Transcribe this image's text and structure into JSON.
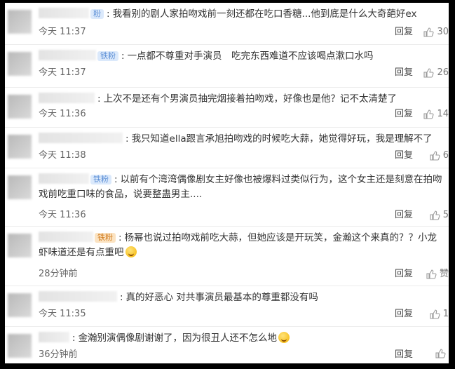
{
  "comments": [
    {
      "badge": "粉",
      "text": "我看别的剧人家拍吻戏前一刻还都在吃口香糖...他到底是什么大奇葩好ex",
      "time": "今天 11:37",
      "reply": "回复",
      "likes": "30"
    },
    {
      "badge": "铁粉",
      "text": "一点都不尊重对手演员　吃完东西难道不应该喝点漱口水吗",
      "time": "今天 11:37",
      "reply": "回复",
      "likes": "26"
    },
    {
      "badge": "",
      "text": "上次不是还有个男演员抽完烟接着拍吻戏，好像也是他？记不太清楚了",
      "time": "今天 11:36",
      "reply": "回复",
      "likes": "14"
    },
    {
      "badge": "",
      "text": "我只知道ella跟言承旭拍吻戏的时候吃大蒜，她觉得好玩，我是理解不了",
      "time": "今天 11:38",
      "reply": "回复",
      "likes": "6"
    },
    {
      "badge": "铁粉",
      "text": "以前有个湾湾偶像剧女主好像也被爆料过类似行为，这个女主还是刻意在拍吻戏前吃重口味的食品，说要整蛊男主....",
      "time": "今天 11:36",
      "reply": "回复",
      "likes": "5"
    },
    {
      "badge": "铁粉",
      "text": "杨幂也说过拍吻戏前吃大蒜，但她应该是开玩笑，金瀚这个来真的？？小龙虾味道还是有点重吧",
      "time": "28分钟前",
      "reply": "回复",
      "likes": "赞"
    },
    {
      "badge": "",
      "text": "真的好恶心 对共事演员最基本的尊重都没有吗",
      "time": "今天 11:35",
      "reply": "回复",
      "likes": "1"
    },
    {
      "badge": "",
      "text": "金瀚别演偶像剧谢谢了，因为很丑人还不怎么地",
      "time": "36分钟前",
      "reply": "回复",
      "likes": ""
    }
  ]
}
